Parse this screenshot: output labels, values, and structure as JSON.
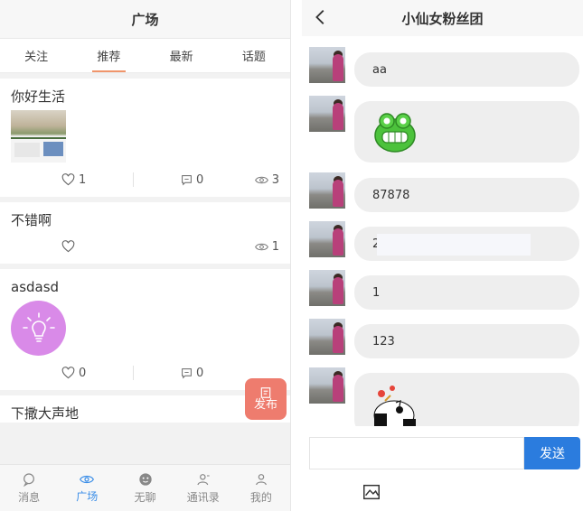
{
  "left": {
    "title": "广场",
    "tabs": [
      "关注",
      "推荐",
      "最新",
      "话题"
    ],
    "active_tab": 1,
    "posts": [
      {
        "title": "你好生活",
        "likes": "1",
        "comments": "0",
        "views": "3"
      },
      {
        "title": "不错啊",
        "views": "1"
      },
      {
        "title": "asdasd",
        "likes": "0",
        "comments": "0"
      },
      {
        "title": "下撒大声地"
      }
    ],
    "publish": {
      "label": "发布"
    },
    "nav": [
      "消息",
      "广场",
      "无聊",
      "通讯录",
      "我的"
    ],
    "active_nav": 1
  },
  "right": {
    "title": "小仙女粉丝团",
    "messages": [
      "aa",
      "87878",
      "2",
      "1",
      "123"
    ],
    "input": {
      "placeholder": "",
      "value": ""
    },
    "send_label": "发送"
  },
  "colors": {
    "accent_blue": "#2b7cde",
    "tab_underline": "#f0956b",
    "publish_bg": "#ee7c6e",
    "bulb_bg": "#d98ae8"
  }
}
